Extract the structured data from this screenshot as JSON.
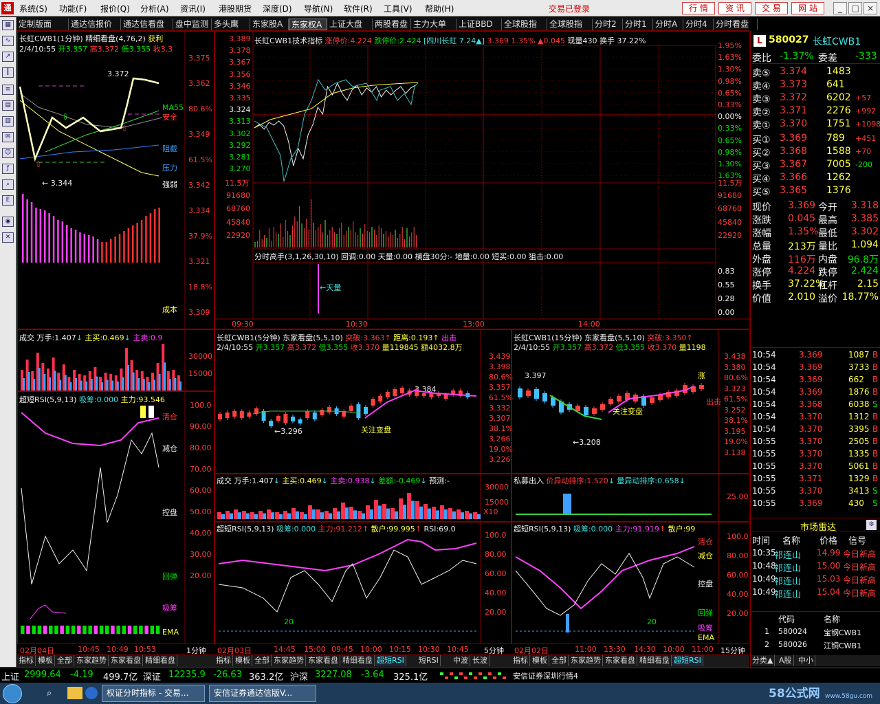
{
  "menu": {
    "items": [
      "系统(S)",
      "功能(F)",
      "报价(Q)",
      "分析(A)",
      "资讯(I)",
      "港股期货",
      "深度(D)",
      "导航(N)",
      "软件(R)",
      "工具(V)",
      "帮助(H)"
    ],
    "status": "交易已登录",
    "right_buttons": [
      "行 情",
      "资 讯",
      "交 易",
      "网 站"
    ]
  },
  "tabs": [
    "定制版面",
    "通达信报价",
    "通达信看盘",
    "盘中监测",
    "多头鹰",
    "东家股A",
    "东家权A",
    "上证大盘",
    "两股看盘",
    "主力大单",
    "上证BBD",
    "全球股指",
    "全球股指",
    "分时2",
    "分时1",
    "分时A",
    "分时4",
    "分时看盘"
  ],
  "active_tab": "东家权A",
  "p1": {
    "title1": "长虹CWB1(1分钟)",
    "title2": "精细看盘(4,76,2)",
    "title3": "获利",
    "info": "2/4/10:55",
    "open": "开3.357",
    "high": "高3.372",
    "low": "低3.355",
    "close": "收3.3",
    "ylabels": [
      "3.375",
      "3.362",
      "80.6%",
      "3.349",
      "61.5%",
      "3.342",
      "3.334",
      "37.9%",
      "3.321",
      "18.8%",
      "3.309"
    ],
    "labels": [
      "MA55",
      "安全",
      "阻截",
      "压力",
      "强弱",
      "成本"
    ],
    "max_note": "3.372",
    "min_note": "← 3.344"
  },
  "p2": {
    "title": "长虹CWB1技术指标",
    "zt": "涨停价:4.224",
    "dt": "跌停价:2.424",
    "rel": "[四川长虹 7.24▲]",
    "price": "3.369",
    "pct": "1.35%",
    "chg": "▲0.045",
    "vol": "现量430",
    "turn": "换手 37.22%",
    "ylabels": [
      "3.389",
      "3.378",
      "3.367",
      "3.356",
      "3.346",
      "3.335",
      "3.324",
      "3.313",
      "3.302",
      "3.292",
      "3.281",
      "3.270"
    ],
    "rlabels": [
      "1.95%",
      "1.63%",
      "1.30%",
      "0.98%",
      "0.65%",
      "0.33%",
      "0.00%",
      "0.33%",
      "0.65%",
      "0.98%",
      "1.30%",
      "1.63%"
    ],
    "vlabels": [
      "11.5万",
      "91680",
      "68760",
      "45840",
      "22920"
    ],
    "rvlabels": [
      "11.5万",
      "91680",
      "68760",
      "45840",
      "22920"
    ],
    "ind": "分时高手(3,1,26,30,10) 回调:0.00 天量:0.00 横盘30分:- 地量:0.00 短买:0.00 狙击:0.00",
    "ind_labels": [
      "0.83",
      "0.55",
      "0.28",
      "0.00"
    ],
    "tianliang": "←天量",
    "times": [
      "09:30",
      "10:30",
      "13:00",
      "14:00"
    ]
  },
  "p3": {
    "title": "成交 万手:1.407",
    "zm": "主买:0.469",
    "zs": "主卖:0.9",
    "ylabels": [
      "30000",
      "15000"
    ]
  },
  "p4": {
    "title": "超短RSI(5,9,13)",
    "xc": "吸筹:0.000",
    "zl": "主力:93.546",
    "ylabels": [
      "100.0",
      "90.00",
      "80.00",
      "70.00",
      "60.00",
      "50.00",
      "40.00",
      "30.00",
      "20.00"
    ],
    "labels": [
      "清仓",
      "减仓",
      "控盘",
      "回弹",
      "吸筹",
      "EMA"
    ],
    "times": [
      "02月04日",
      "10:45",
      "10:49",
      "10:53"
    ],
    "period": "1分钟"
  },
  "p5": {
    "title": "长虹CWB1(5分钟) 东家看盘(5,5,10)",
    "tp": "突破:3.363",
    "jl": "距离:0.193",
    "cc": "出击",
    "info": "2/4/10:55",
    "open": "开3.357",
    "high": "高3.372",
    "low": "低3.355",
    "close": "收3.370",
    "vol": "量119845",
    "amt": "额4032.8万",
    "ylabels": [
      "3.439",
      "3.398",
      "80.6%",
      "3.357",
      "61.5%",
      "3.332",
      "3.307",
      "38.1%",
      "3.266",
      "19.0%",
      "3.226"
    ],
    "note1": "←3.296",
    "note2": "3.384",
    "gz": "关注变盘"
  },
  "p6": {
    "title": "长虹CWB1(15分钟) 东家看盘(5,5,10)",
    "tp": "突破:3.350",
    "info": "2/4/10:55",
    "open": "开3.357",
    "high": "高3.372",
    "low": "低3.355",
    "close": "收3.370",
    "vol": "量1198",
    "ylabels": [
      "3.438",
      "3.380",
      "80.6%",
      "3.323",
      "61.5%",
      "3.252",
      "38.1%",
      "3.195",
      "19.0%",
      "3.138"
    ],
    "note1": "3.397",
    "note2": "←3.208",
    "gz": "关注变盘",
    "zhang": "涨",
    "chu": "出击"
  },
  "p7": {
    "title": "成交 万手:1.407",
    "zm": "主买:0.469",
    "zs": "主卖:0.938",
    "ce": "差额:-0.469",
    "yc": "预测:-",
    "ylabels": [
      "30000",
      "15000",
      "X10"
    ]
  },
  "p8": {
    "title": "私募出入",
    "yd": "价异动排序:1.520",
    "ld": "量异动排序:0.658",
    "ylabels": [
      "25.00"
    ]
  },
  "p9": {
    "title": "超短RSI(5,9,13)",
    "xc": "吸筹:0.000",
    "zl": "主力:91.212",
    "sh": "散户:99.995",
    "rsi": "RSI:69.0",
    "ylabels": [
      "100.0",
      "80.00",
      "60.00",
      "40.00",
      "20.00"
    ],
    "mark": "20",
    "times": [
      "02月03日",
      "14:45",
      "15:00",
      "09:45",
      "10:00",
      "10:15",
      "10:30",
      "10:45"
    ],
    "period": "5分钟"
  },
  "p10": {
    "title": "超短RSI(5,9,13)",
    "xc": "吸筹:0.000",
    "zl": "主力:91.919",
    "sh": "散户:99",
    "ylabels": [
      "100.0",
      "80.00",
      "60.00",
      "40.00",
      "20.00"
    ],
    "labels": [
      "清仓",
      "减仓",
      "控盘",
      "回弹",
      "吸筹",
      "EMA"
    ],
    "mark": "20",
    "times": [
      "02月02日",
      "11:00",
      "13:30",
      "14:30",
      "10:00",
      "11:00"
    ],
    "period": "15分钟"
  },
  "bottom_tabs_left": [
    "指标",
    "模板",
    "全部",
    "东家趋势",
    "东家看盘",
    "精细看盘"
  ],
  "bottom_tabs_mid": [
    "指标",
    "模板",
    "全部",
    "东家趋势",
    "东家看盘",
    "精细看盘",
    "超短RSI",
    "短RSI",
    "中波",
    "长波"
  ],
  "bottom_tabs_right": [
    "指标",
    "模板",
    "全部",
    "东家趋势",
    "东家看盘",
    "精细看盘",
    "超短RSI"
  ],
  "quote": {
    "code": "580027",
    "name": "长虹CWB1",
    "wb": "委比",
    "wb_v": "-1.37%",
    "wc": "委差",
    "wc_v": "-333",
    "sells": [
      [
        "卖⑤",
        "3.374",
        "1483",
        ""
      ],
      [
        "卖④",
        "3.373",
        "641",
        ""
      ],
      [
        "卖③",
        "3.372",
        "6202",
        "+57"
      ],
      [
        "卖②",
        "3.371",
        "2276",
        "+992"
      ],
      [
        "卖①",
        "3.370",
        "1751",
        "+1098"
      ]
    ],
    "buys": [
      [
        "买①",
        "3.369",
        "789",
        "+451"
      ],
      [
        "买②",
        "3.368",
        "1588",
        "+70"
      ],
      [
        "买③",
        "3.367",
        "7005",
        "-200"
      ],
      [
        "买④",
        "3.366",
        "1262",
        ""
      ],
      [
        "买⑤",
        "3.365",
        "1376",
        ""
      ]
    ],
    "stats": [
      [
        "现价",
        "3.369",
        "今开",
        "3.318"
      ],
      [
        "涨跌",
        "0.045",
        "最高",
        "3.385"
      ],
      [
        "涨幅",
        "1.35%",
        "最低",
        "3.302"
      ],
      [
        "总量",
        "213万",
        "量比",
        "1.094"
      ],
      [
        "外盘",
        "116万",
        "内盘",
        "96.8万"
      ],
      [
        "涨停",
        "4.224",
        "跌停",
        "2.424"
      ],
      [
        "换手",
        "37.22%",
        "杠杆",
        "2.15"
      ],
      [
        "价值",
        "2.010",
        "溢价",
        "18.77%"
      ]
    ],
    "ticks": [
      [
        "10:54",
        "3.369",
        "1087",
        "B"
      ],
      [
        "10:54",
        "3.369",
        "3733",
        "B"
      ],
      [
        "10:54",
        "3.369",
        "662",
        "B"
      ],
      [
        "10:54",
        "3.369",
        "1876",
        "B"
      ],
      [
        "10:54",
        "3.368",
        "6038",
        "S"
      ],
      [
        "10:54",
        "3.370",
        "1312",
        "B"
      ],
      [
        "10:54",
        "3.370",
        "3395",
        "B"
      ],
      [
        "10:55",
        "3.370",
        "2505",
        "B"
      ],
      [
        "10:55",
        "3.370",
        "1335",
        "B"
      ],
      [
        "10:55",
        "3.370",
        "5061",
        "B"
      ],
      [
        "10:55",
        "3.371",
        "1329",
        "B"
      ],
      [
        "10:55",
        "3.370",
        "3413",
        "S"
      ],
      [
        "10:55",
        "3.369",
        "430",
        "S"
      ]
    ],
    "radar_title": "市场雷达",
    "radar_head": [
      "时间",
      "名称",
      "价格",
      "信号"
    ],
    "radar": [
      [
        "10:35",
        "祁连山",
        "14.99",
        "今日新高"
      ],
      [
        "10:48",
        "祁连山",
        "15.00",
        "今日新高"
      ],
      [
        "10:49",
        "祁连山",
        "15.03",
        "今日新高"
      ],
      [
        "10:49",
        "祁连山",
        "15.04",
        "今日新高"
      ]
    ],
    "list_head": [
      "代码",
      "名称"
    ],
    "list": [
      [
        "1",
        "580024",
        "宝钢CWB1"
      ],
      [
        "2",
        "580026",
        "江铜CWB1"
      ]
    ],
    "btm": [
      "分类▲",
      "A股",
      "中小"
    ]
  },
  "status": {
    "sh": "上证",
    "sh_v": "2999.64",
    "sh_c": "-4.19",
    "sh_a": "499.7亿",
    "sz": "深证",
    "sz_v": "12235.9",
    "sz_c": "-26.63",
    "sz_a": "363.2亿",
    "hs": "沪深",
    "hs_v": "3227.08",
    "hs_c": "-3.64",
    "hs_a": "325.1亿",
    "broker": "安信证券深圳行情4"
  },
  "taskbar": {
    "items": [
      "权证分时指标 - 交易...",
      "安信证券通达信版V..."
    ],
    "watermark": "58公式网",
    "wm_url": "www.58gu.com"
  }
}
